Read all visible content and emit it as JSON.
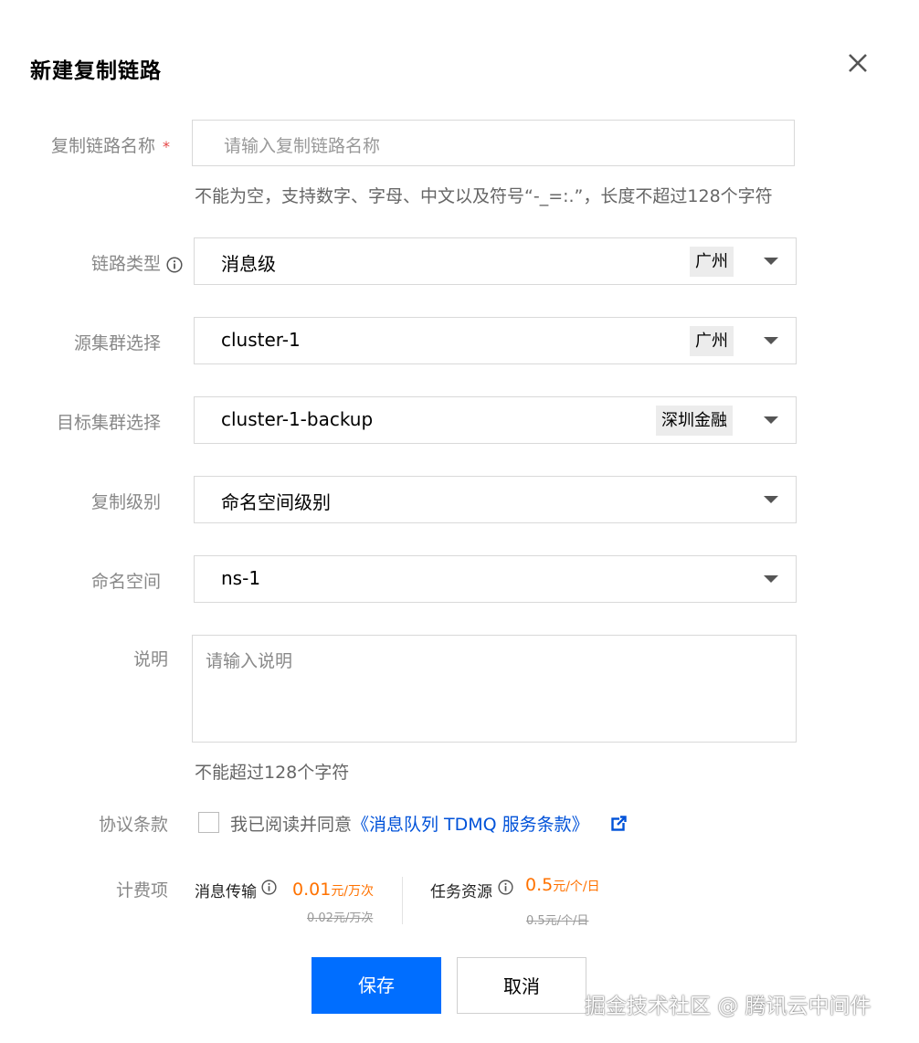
{
  "dialog": {
    "title": "新建复制链路",
    "close_label": "×"
  },
  "form": {
    "name": {
      "label": "复制链路名称",
      "required_mark": "*",
      "placeholder": "请输入复制链路名称",
      "hint": "不能为空，支持数字、字母、中文以及符号“-_=:.”，长度不超过128个字符"
    },
    "link_type": {
      "label": "链路类型",
      "value": "消息级",
      "region": "广州"
    },
    "source_cluster": {
      "label": "源集群选择",
      "value": "cluster-1",
      "region": "广州"
    },
    "target_cluster": {
      "label": "目标集群选择",
      "value": "cluster-1-backup",
      "region": "深圳金融"
    },
    "replication_level": {
      "label": "复制级别",
      "value": "命名空间级别"
    },
    "namespace": {
      "label": "命名空间",
      "value": "ns-1"
    },
    "description": {
      "label": "说明",
      "placeholder": "请输入说明",
      "hint": "不能超过128个字符"
    },
    "agreement": {
      "label": "协议条款",
      "checked": false,
      "prefix": "我已阅读并同意",
      "link_text": "《消息队列 TDMQ 服务条款》"
    },
    "billing": {
      "label": "计费项",
      "items": [
        {
          "name": "消息传输",
          "price": "0.01",
          "unit": "元/万次",
          "original": "0.02元/万次"
        },
        {
          "name": "任务资源",
          "price": "0.5",
          "unit": "元/个/日",
          "original": "0.5元/个/日"
        }
      ]
    }
  },
  "buttons": {
    "save": "保存",
    "cancel": "取消"
  },
  "watermark": "掘金技术社区 @ 腾讯云中间件",
  "colors": {
    "primary": "#006eff",
    "price": "#ff7200",
    "link": "#0052d9",
    "required": "#e54545"
  }
}
